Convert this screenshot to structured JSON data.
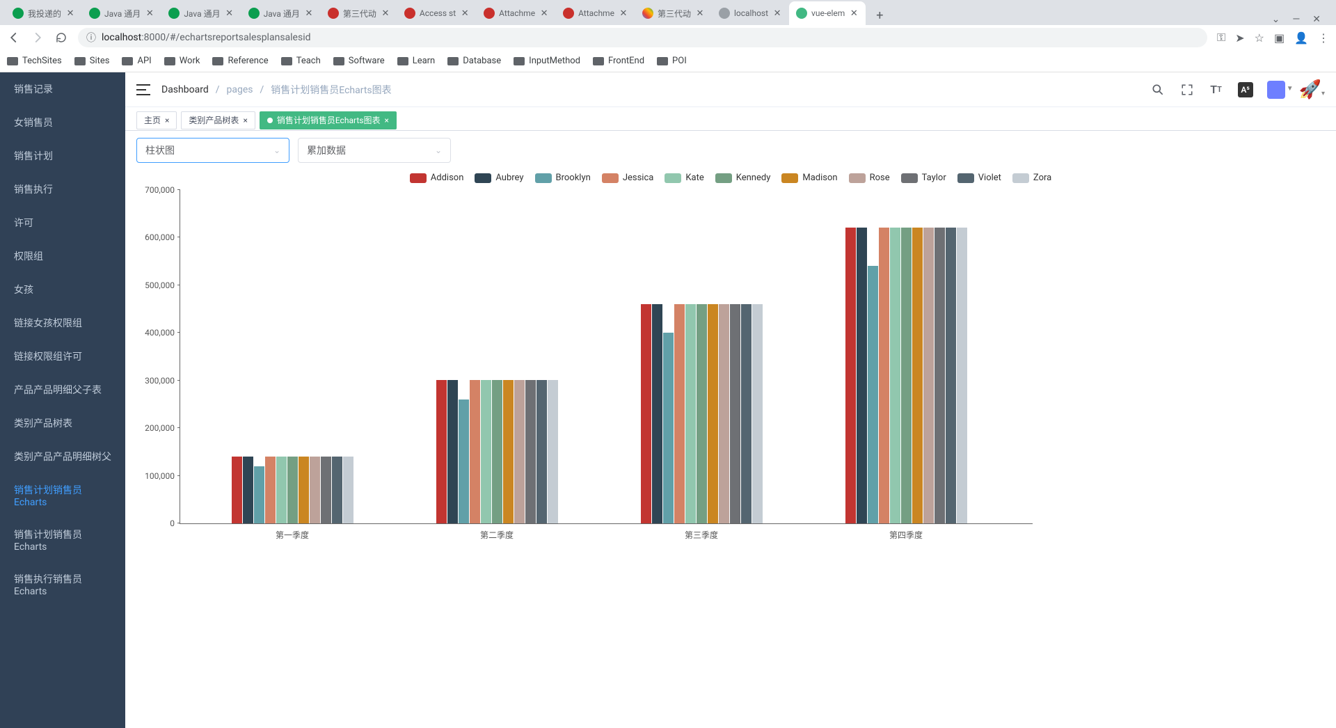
{
  "browser": {
    "tabs": [
      {
        "title": "我投递的",
        "favicon": "fav-green"
      },
      {
        "title": "Java 通月",
        "favicon": "fav-green"
      },
      {
        "title": "Java 通月",
        "favicon": "fav-green"
      },
      {
        "title": "Java 通月",
        "favicon": "fav-green"
      },
      {
        "title": "第三代动",
        "favicon": "fav-red"
      },
      {
        "title": "Access st",
        "favicon": "fav-red"
      },
      {
        "title": "Attachme",
        "favicon": "fav-red"
      },
      {
        "title": "Attachme",
        "favicon": "fav-red"
      },
      {
        "title": "第三代动",
        "favicon": "fav-chart"
      },
      {
        "title": "localhost",
        "favicon": "fav-grey"
      },
      {
        "title": "vue-elem",
        "favicon": "fav-vue",
        "active": true
      }
    ],
    "url_host": "localhost",
    "url_port_path": ":8000/#/echartsreportsalesplansalesid"
  },
  "bookmarks": [
    "TechSites",
    "Sites",
    "API",
    "Work",
    "Reference",
    "Teach",
    "Software",
    "Learn",
    "Database",
    "InputMethod",
    "FrontEnd",
    "POI"
  ],
  "sidebar": {
    "items": [
      {
        "label": "销售记录"
      },
      {
        "label": "女销售员"
      },
      {
        "label": "销售计划"
      },
      {
        "label": "销售执行"
      },
      {
        "label": "许可"
      },
      {
        "label": "权限组"
      },
      {
        "label": "女孩"
      },
      {
        "label": "链接女孩权限组"
      },
      {
        "label": "链接权限组许可"
      },
      {
        "label": "产品产品明细父子表"
      },
      {
        "label": "类别产品树表"
      },
      {
        "label": "类别产品产品明细树父"
      },
      {
        "label": "销售计划销售员Echarts",
        "active": true
      },
      {
        "label": "销售计划销售员Echarts"
      },
      {
        "label": "销售执行销售员Echarts"
      }
    ]
  },
  "breadcrumb": {
    "first": "Dashboard",
    "second": "pages",
    "third": "销售计划销售员Echarts图表",
    "sep": "/"
  },
  "page_tabs": [
    {
      "label": "主页"
    },
    {
      "label": "类别产品树表"
    },
    {
      "label": "销售计划销售员Echarts图表",
      "active": true
    }
  ],
  "controls": {
    "select1": "柱状图",
    "select2": "累加数据"
  },
  "chart_data": {
    "type": "bar",
    "categories": [
      "第一季度",
      "第二季度",
      "第三季度",
      "第四季度"
    ],
    "series": [
      {
        "name": "Addison",
        "color": "#c23531",
        "values": [
          140000,
          300000,
          460000,
          620000
        ]
      },
      {
        "name": "Aubrey",
        "color": "#2f4554",
        "values": [
          140000,
          300000,
          460000,
          620000
        ]
      },
      {
        "name": "Brooklyn",
        "color": "#61a0a8",
        "values": [
          120000,
          260000,
          400000,
          540000
        ]
      },
      {
        "name": "Jessica",
        "color": "#d48265",
        "values": [
          140000,
          300000,
          460000,
          620000
        ]
      },
      {
        "name": "Kate",
        "color": "#91c7ae",
        "values": [
          140000,
          300000,
          460000,
          620000
        ]
      },
      {
        "name": "Kennedy",
        "color": "#749f83",
        "values": [
          140000,
          300000,
          460000,
          620000
        ]
      },
      {
        "name": "Madison",
        "color": "#ca8622",
        "values": [
          140000,
          300000,
          460000,
          620000
        ]
      },
      {
        "name": "Rose",
        "color": "#bda29a",
        "values": [
          140000,
          300000,
          460000,
          620000
        ]
      },
      {
        "name": "Taylor",
        "color": "#6e7074",
        "values": [
          140000,
          300000,
          460000,
          620000
        ]
      },
      {
        "name": "Violet",
        "color": "#546570",
        "values": [
          140000,
          300000,
          460000,
          620000
        ]
      },
      {
        "name": "Zora",
        "color": "#c4ccd3",
        "values": [
          140000,
          300000,
          460000,
          620000
        ]
      }
    ],
    "ylim": [
      0,
      700000
    ],
    "yticks": [
      0,
      100000,
      200000,
      300000,
      400000,
      500000,
      600000,
      700000
    ]
  }
}
